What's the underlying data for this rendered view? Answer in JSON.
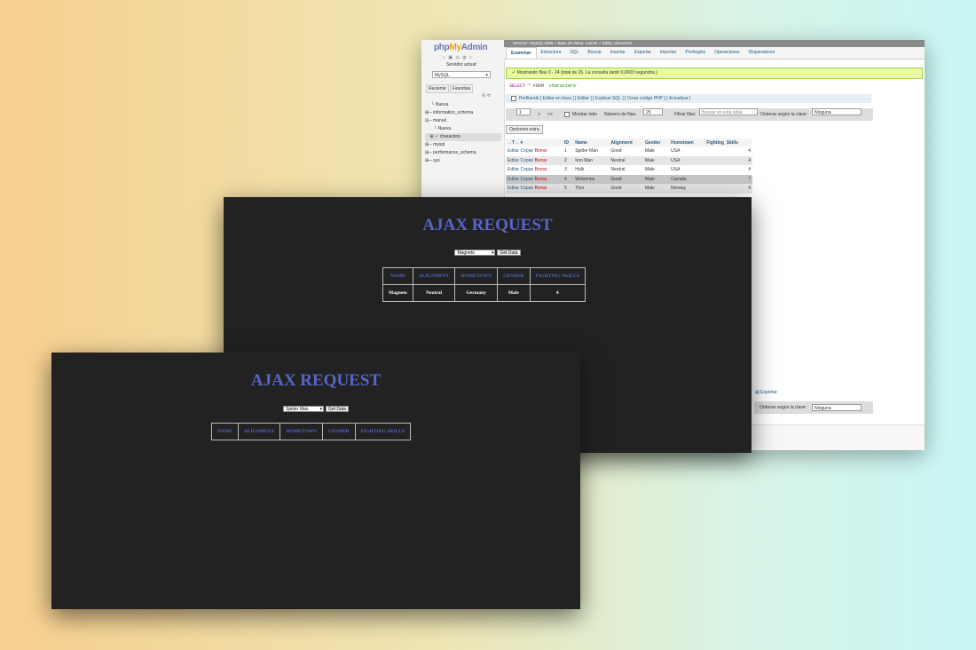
{
  "pma": {
    "logo": {
      "php": "php",
      "my": "My",
      "admin": "Admin"
    },
    "server_label": "Servidor actual:",
    "server_value": "MySQL",
    "nav_tabs": [
      "Reciente",
      "Favoritas"
    ],
    "tree": [
      "Nueva",
      "information_schema",
      "marvel",
      "Nueva",
      "characters",
      "mysql",
      "performance_schema",
      "sys"
    ],
    "breadcrumb": "Servidor: MySQL:3306 » Base de datos: marvel » Tabla: characters",
    "tabs": [
      "Examinar",
      "Estructura",
      "SQL",
      "Buscar",
      "Insertar",
      "Exportar",
      "Importar",
      "Privilegios",
      "Operaciones",
      "Disparadores"
    ],
    "success_msg": "Mostrando filas 0 - 24 (total de 26. La consulta tardó 0,0003 segundos.)",
    "sql": {
      "select": "SELECT",
      "rest": " * FROM ",
      "table": "`characters`"
    },
    "profiling": "Perfilando [ Editar en línea ] [ Editar ] [ Explicar SQL ] [ Crear código PHP ] [ Actualizar ]",
    "nav": {
      "page": "1",
      "next": ">",
      "last": ">>",
      "show_all": "Mostrar todo",
      "rows_label": "Número de filas:",
      "rows_value": "25",
      "filter_label": "Filtrar filas:",
      "filter_placeholder": "Buscar en esta tabla",
      "order_label": "Ordenar según la clave:",
      "order_value": "Ninguna"
    },
    "extra_options": "Opciones extra",
    "table": {
      "headers": [
        "ID",
        "Name",
        "Alignment",
        "Gender",
        "Hometown",
        "Fighting_Skills"
      ],
      "actions": {
        "edit": "Editar",
        "copy": "Copiar",
        "delete": "Borrar"
      },
      "rows": [
        [
          "1",
          "Spider Man",
          "Good",
          "Male",
          "USA",
          "4"
        ],
        [
          "2",
          "Iron Man",
          "Neutral",
          "Male",
          "USA",
          "4"
        ],
        [
          "3",
          "Hulk",
          "Neutral",
          "Male",
          "USA",
          "4"
        ],
        [
          "4",
          "Wolverine",
          "Good",
          "Male",
          "Canada",
          "7"
        ],
        [
          "5",
          "Thor",
          "Good",
          "Male",
          "Norway",
          "4"
        ]
      ]
    },
    "export_link": "Exportar"
  },
  "ajax_top": {
    "title": "AJAX REQUEST",
    "selected": "Magneto",
    "button": "Get Data",
    "headers": [
      "NAME",
      "ALIGNMENT",
      "HOMETOWN",
      "GENDER",
      "FIGHTING SKILLS"
    ],
    "row": [
      "Magneto",
      "Neutral",
      "Germany",
      "Male",
      "4"
    ]
  },
  "ajax_bottom": {
    "title": "AJAX REQUEST",
    "selected": "Spider Man",
    "button": "Get Data",
    "headers": [
      "NAME",
      "ALIGNMENT",
      "HOMETOWN",
      "GENDER",
      "FIGHTING SKILLS"
    ]
  }
}
